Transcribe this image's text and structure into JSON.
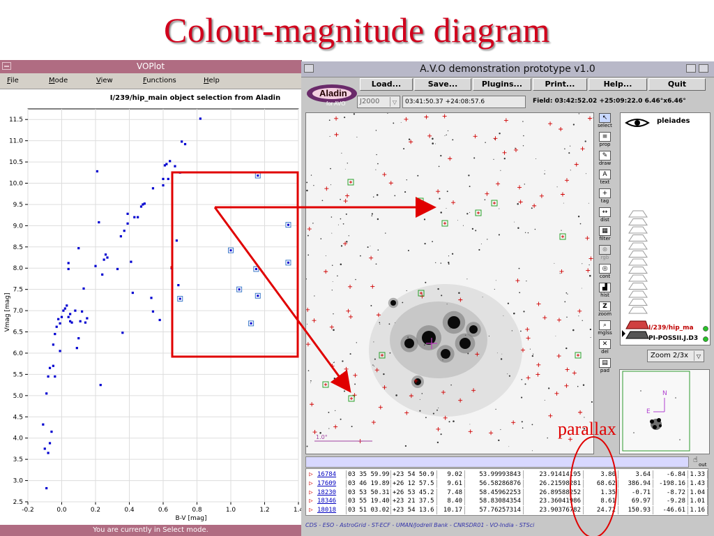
{
  "slide_title": "Colour-magnitude diagram",
  "voplot": {
    "window_title": "VOPlot",
    "menu": [
      "File",
      "Mode",
      "View",
      "Functions",
      "Help"
    ],
    "plot_title": "I/239/hip_main object selection from Aladin",
    "status": "You are currently in Select mode."
  },
  "chart_data": {
    "type": "scatter",
    "title": "I/239/hip_main object selection from Aladin",
    "xlabel": "B-V [mag]",
    "ylabel": "Vmag [mag]",
    "xlim": [
      -0.2,
      1.4
    ],
    "ylim": [
      2.5,
      11.75
    ],
    "y_inverted": false,
    "x_ticks": [
      "-0.2",
      "0.0",
      "0.2",
      "0.4",
      "0.6",
      "0.8",
      "1.0",
      "1.2",
      "1.4"
    ],
    "y_ticks": [
      "2.5",
      "3.0",
      "3.5",
      "4.0",
      "4.5",
      "5.0",
      "5.5",
      "6.0",
      "6.5",
      "7.0",
      "7.5",
      "8.0",
      "8.5",
      "9.0",
      "9.5",
      "10.0",
      "10.5",
      "11.0",
      "11.5"
    ],
    "grid": true,
    "series": [
      {
        "color": "#0000d0",
        "marker": "dot",
        "points": [
          [
            -0.11,
            4.32
          ],
          [
            -0.1,
            3.75
          ],
          [
            -0.08,
            3.65
          ],
          [
            -0.07,
            3.88
          ],
          [
            -0.06,
            4.15
          ],
          [
            -0.09,
            2.82
          ],
          [
            -0.09,
            5.05
          ],
          [
            -0.08,
            5.45
          ],
          [
            -0.07,
            5.65
          ],
          [
            -0.05,
            5.7
          ],
          [
            -0.04,
            5.45
          ],
          [
            -0.05,
            6.2
          ],
          [
            -0.04,
            6.45
          ],
          [
            -0.03,
            6.62
          ],
          [
            -0.02,
            6.8
          ],
          [
            -0.01,
            6.05
          ],
          [
            -0.01,
            6.7
          ],
          [
            0.0,
            6.85
          ],
          [
            0.01,
            7.0
          ],
          [
            0.02,
            7.05
          ],
          [
            0.03,
            7.12
          ],
          [
            0.04,
            6.85
          ],
          [
            0.05,
            6.75
          ],
          [
            0.05,
            6.92
          ],
          [
            0.06,
            6.72
          ],
          [
            0.04,
            7.98
          ],
          [
            0.04,
            8.12
          ],
          [
            0.08,
            7.0
          ],
          [
            0.09,
            6.12
          ],
          [
            0.1,
            6.35
          ],
          [
            0.11,
            6.75
          ],
          [
            0.12,
            6.98
          ],
          [
            0.13,
            7.52
          ],
          [
            0.14,
            6.72
          ],
          [
            0.15,
            6.82
          ],
          [
            0.1,
            8.47
          ],
          [
            0.2,
            8.05
          ],
          [
            0.21,
            10.28
          ],
          [
            0.22,
            9.08
          ],
          [
            0.23,
            5.25
          ],
          [
            0.24,
            7.85
          ],
          [
            0.25,
            8.2
          ],
          [
            0.26,
            8.32
          ],
          [
            0.27,
            8.25
          ],
          [
            0.33,
            7.98
          ],
          [
            0.35,
            8.75
          ],
          [
            0.36,
            6.48
          ],
          [
            0.37,
            8.88
          ],
          [
            0.39,
            9.05
          ],
          [
            0.39,
            9.28
          ],
          [
            0.41,
            8.15
          ],
          [
            0.42,
            7.42
          ],
          [
            0.43,
            9.2
          ],
          [
            0.45,
            9.2
          ],
          [
            0.47,
            9.45
          ],
          [
            0.48,
            9.5
          ],
          [
            0.49,
            9.52
          ],
          [
            0.53,
            7.3
          ],
          [
            0.54,
            6.98
          ],
          [
            0.54,
            9.88
          ],
          [
            0.58,
            6.78
          ],
          [
            0.6,
            10.1
          ],
          [
            0.6,
            9.95
          ],
          [
            0.61,
            10.42
          ],
          [
            0.62,
            10.45
          ],
          [
            0.63,
            10.1
          ],
          [
            0.64,
            10.52
          ],
          [
            0.65,
            8.0
          ],
          [
            0.67,
            10.4
          ],
          [
            0.68,
            8.65
          ],
          [
            0.69,
            7.6
          ],
          [
            0.7,
            10.25
          ],
          [
            0.71,
            10.98
          ],
          [
            0.73,
            10.92
          ],
          [
            0.82,
            11.52
          ]
        ]
      },
      {
        "color": "#d00000",
        "marker": "dot",
        "points": [
          [
            0.65,
            8.02
          ]
        ]
      },
      {
        "color": "#0000d0",
        "marker": "boxed",
        "points": [
          [
            0.7,
            7.28
          ],
          [
            1.0,
            8.42
          ],
          [
            1.05,
            7.5
          ],
          [
            1.12,
            6.7
          ],
          [
            1.15,
            7.98
          ],
          [
            1.16,
            7.35
          ],
          [
            1.16,
            10.18
          ],
          [
            1.34,
            9.02
          ],
          [
            1.34,
            8.13
          ]
        ]
      }
    ]
  },
  "avo": {
    "window_title": "A.V.O demonstration prototype v1.0",
    "logo_sub": "for AVO",
    "buttons": [
      "Load...",
      "Save...",
      "Plugins...",
      "Print...",
      "Help...",
      "Quit"
    ],
    "frame": "J2000",
    "target": "03:41:50.37 +24:08:57.6",
    "field_info": "Field: 03:42:52.02 +25:09:22.0  6.46°x6.46°",
    "tools": [
      "select",
      "prop",
      "draw",
      "text",
      "tag",
      "dist",
      "filter",
      "rgb",
      "cont",
      "hist",
      "zoom",
      "mglss",
      "del",
      "pad"
    ],
    "stack_top_label": "pleiades",
    "planes": [
      "I/239/hip_ma",
      "PI-POSSII.J.D3"
    ],
    "zoom": "Zoom 2/3x",
    "scale_label": "1.0°",
    "thumb_n": "N",
    "thumb_e": "E",
    "out_label": "out",
    "credits": "CDS - ESO - AstroGrid - ST-ECF - UMAN/Jodrell Bank - CNRSDR01 - VO-India - STSci"
  },
  "table": {
    "rows": [
      [
        "16784",
        "03 35 59.99",
        "+23 54 50.9",
        "9.02",
        "53.99993843",
        "23.91414195",
        "3.80",
        "3.64",
        "-6.84",
        "1.33"
      ],
      [
        "17609",
        "03 46 19.89",
        "+26 12 57.5",
        "9.61",
        "56.58286876",
        "26.21598281",
        "68.62",
        "386.94",
        "-198.16",
        "1.43"
      ],
      [
        "18230",
        "03 53 50.31",
        "+26 53 45.2",
        "7.48",
        "58.45962253",
        "26.89588252",
        "1.35",
        "-0.71",
        "-8.72",
        "1.04"
      ],
      [
        "18346",
        "03 55 19.40",
        "+23 21 37.5",
        "8.40",
        "58.83084354",
        "23.36041986",
        "8.61",
        "69.97",
        "-9.28",
        "1.01"
      ],
      [
        "18018",
        "03 51 03.02",
        "+23 54 13.6",
        "10.17",
        "57.76257314",
        "23.90376782",
        "24.72",
        "150.93",
        "-46.61",
        "1.16"
      ]
    ]
  },
  "annotation": {
    "label": "parallax",
    "color": "#e00000"
  }
}
